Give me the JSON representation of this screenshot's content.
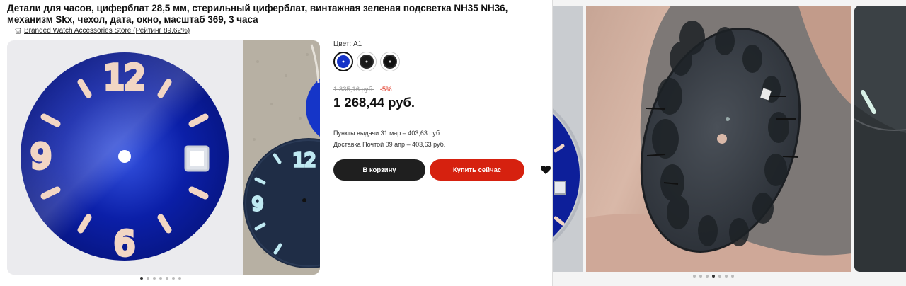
{
  "product": {
    "title": "Детали для часов, циферблат 28,5 мм, стерильный циферблат, винтажная зеленая подсветка NH35 NH36, механизм Skx, чехол, дата, окно, масштаб 369, 3 часа",
    "store_name": "Branded Watch Accessories Store (Рейтинг 89.62%)",
    "store_icon": "store-icon"
  },
  "gallery": {
    "dial_numbers": {
      "top": "12",
      "left": "9",
      "bottom": "6"
    },
    "side_numbers": {
      "top": "12",
      "left": "9"
    },
    "dots_count": 7,
    "active_dot": 0,
    "colors": {
      "dial_blue": "#0b1fa8",
      "dial_lume": "#f2d6c4",
      "side_dial": "#1f2d46",
      "side_lume": "#bfe9f2"
    }
  },
  "buy_box": {
    "color_label": "Цвет: А1",
    "swatches": [
      {
        "name": "A1 blue",
        "color": "#1634c8",
        "selected": true
      },
      {
        "name": "black 1",
        "color": "#1a1a1a",
        "selected": false
      },
      {
        "name": "black 2",
        "color": "#111111",
        "selected": false
      }
    ],
    "old_price": "1 335,16 руб.",
    "discount": "-5%",
    "price": "1 268,44 руб.",
    "pickup": "Пункты выдачи 31 мар – 403,63 руб.",
    "post": "Доставка Почтой 09 апр – 403,63 руб.",
    "cart_label": "В корзину",
    "buy_now_label": "Купить сейчас",
    "colors": {
      "cart_btn": "#1f1f1f",
      "buy_btn": "#d6210f",
      "discount": "#e0301e"
    }
  },
  "right_carousel": {
    "dots_count": 7,
    "active_dot": 3
  }
}
